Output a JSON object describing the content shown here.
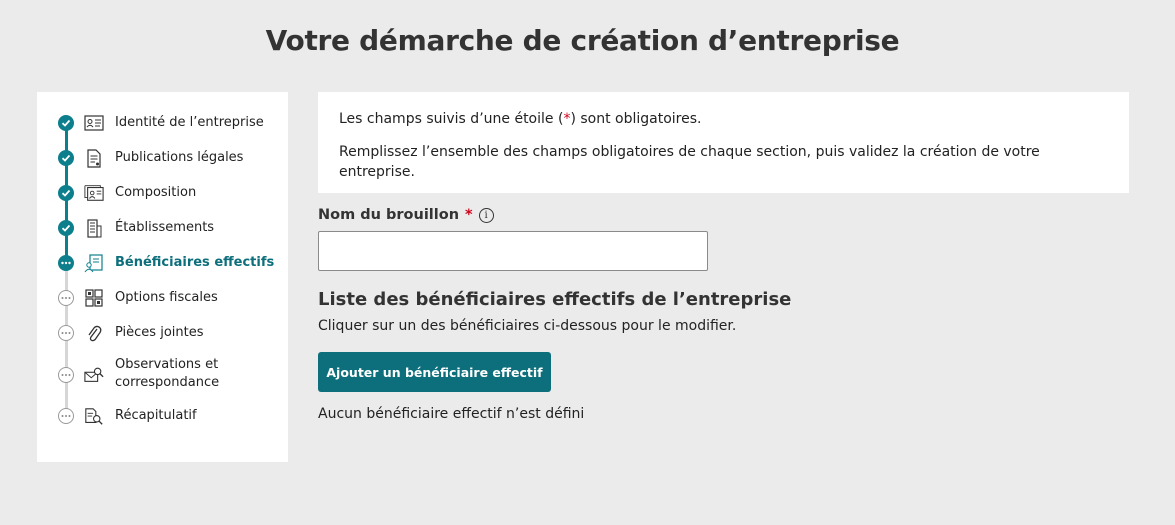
{
  "page": {
    "title": "Votre démarche de création d’entreprise"
  },
  "colors": {
    "accent": "#0d7e8c",
    "button": "#0d6f7c",
    "required": "#d0021b"
  },
  "sidebar": {
    "steps": [
      {
        "label": "Identité de l’entreprise",
        "status": "done",
        "icon": "id-card-icon"
      },
      {
        "label": "Publications légales",
        "status": "done",
        "icon": "document-icon"
      },
      {
        "label": "Composition",
        "status": "done",
        "icon": "people-list-icon"
      },
      {
        "label": "Établissements",
        "status": "done",
        "icon": "building-icon"
      },
      {
        "label": "Bénéficiaires effectifs",
        "status": "current",
        "icon": "beneficiaries-icon"
      },
      {
        "label": "Options fiscales",
        "status": "todo",
        "icon": "grid-icon"
      },
      {
        "label": "Pièces jointes",
        "status": "todo",
        "icon": "paperclip-icon"
      },
      {
        "label": "Observations et",
        "label2": "correspondance",
        "status": "todo",
        "icon": "mail-search-icon"
      },
      {
        "label": "Récapitulatif",
        "status": "todo",
        "icon": "summary-search-icon"
      }
    ]
  },
  "info": {
    "line1_before": "Les champs suivis d’une étoile (",
    "line1_star": "*",
    "line1_after": ") sont obligatoires.",
    "line2": "Remplissez l’ensemble des champs obligatoires de chaque section, puis validez la création de votre entreprise."
  },
  "draft": {
    "label": "Nom du brouillon",
    "required_mark": "*",
    "info_glyph": "i",
    "value": ""
  },
  "beneficiaries": {
    "title": "Liste des bénéficiaires effectifs de l’entreprise",
    "subtitle": "Cliquer sur un des bénéficiaires ci-dessous pour le modifier.",
    "add_button": "Ajouter un bénéficiaire effectif",
    "empty_message": "Aucun bénéficiaire effectif n’est défini"
  }
}
